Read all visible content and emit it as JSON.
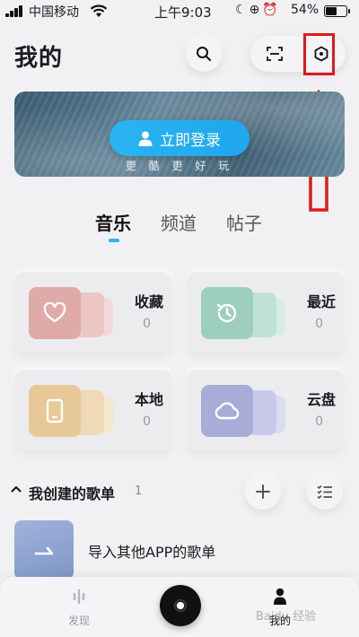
{
  "status_bar": {
    "carrier": "中国移动",
    "time": "上午9:03",
    "battery_percent": "54%",
    "battery_level": 0.54
  },
  "header": {
    "title": "我的"
  },
  "banner": {
    "login_label": "立即登录",
    "slogan": "更 酷 更 好 玩"
  },
  "tabs": [
    {
      "label": "音乐",
      "active": true
    },
    {
      "label": "频道",
      "active": false
    },
    {
      "label": "帖子",
      "active": false
    }
  ],
  "cards": [
    {
      "title": "收藏",
      "count": "0",
      "icon": "heart-icon",
      "color": "#e2a9a6"
    },
    {
      "title": "最近",
      "count": "0",
      "icon": "clock-icon",
      "color": "#9fd1be"
    },
    {
      "title": "本地",
      "count": "0",
      "icon": "phone-icon",
      "color": "#eacb9d"
    },
    {
      "title": "云盘",
      "count": "0",
      "icon": "cloud-icon",
      "color": "#aeb0dc"
    }
  ],
  "playlist_section": {
    "title": "我创建的歌单",
    "count": "1",
    "items": [
      {
        "name": "导入其他APP的歌单"
      }
    ]
  },
  "bottom_nav": [
    {
      "label": "发现",
      "active": false
    },
    {
      "label": "我的",
      "active": true
    }
  ],
  "watermark": "Baidu 经验",
  "colors": {
    "accent": "#29b4f2",
    "annotation": "#e0191b",
    "background": "#f1f1f3"
  }
}
